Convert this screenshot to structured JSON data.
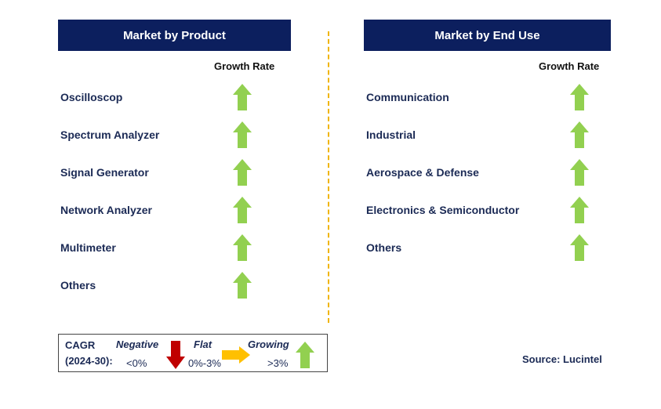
{
  "left": {
    "title": "Market by Product",
    "growth_label": "Growth Rate",
    "items": [
      {
        "label": "Oscilloscop",
        "trend": "growing"
      },
      {
        "label": "Spectrum Analyzer",
        "trend": "growing"
      },
      {
        "label": "Signal Generator",
        "trend": "growing"
      },
      {
        "label": "Network Analyzer",
        "trend": "growing"
      },
      {
        "label": "Multimeter",
        "trend": "growing"
      },
      {
        "label": "Others",
        "trend": "growing"
      }
    ]
  },
  "right": {
    "title": "Market by End Use",
    "growth_label": "Growth Rate",
    "items": [
      {
        "label": "Communication",
        "trend": "growing"
      },
      {
        "label": "Industrial",
        "trend": "growing"
      },
      {
        "label": "Aerospace & Defense",
        "trend": "growing"
      },
      {
        "label": "Electronics & Semiconductor",
        "trend": "growing"
      },
      {
        "label": "Others",
        "trend": "growing"
      }
    ]
  },
  "legend": {
    "cagr": "CAGR",
    "period": "(2024-30):",
    "negative": "Negative",
    "negative_range": "<0%",
    "flat": "Flat",
    "flat_range": "0%-3%",
    "growing": "Growing",
    "growing_range": ">3%"
  },
  "source": "Source: Lucintel",
  "colors": {
    "header": "#0c1f5e",
    "growing": "#92d050",
    "negative": "#c00000",
    "flat": "#ffc000",
    "divider": "#f0b400"
  }
}
